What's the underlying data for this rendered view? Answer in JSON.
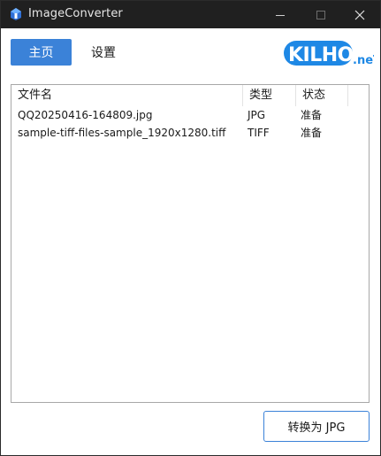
{
  "window": {
    "title": "ImageConverter",
    "icon": "app-icon",
    "controls": [
      "minimize-icon",
      "maximize-icon",
      "close-icon"
    ]
  },
  "nav": {
    "home_label": "主页",
    "settings_label": "设置",
    "active": "home",
    "accent_color": "#3b82d8"
  },
  "logo": {
    "text": "KILHO",
    "suffix": ".neT",
    "color": "#1e88e5"
  },
  "file_list": {
    "columns": [
      "文件名",
      "类型",
      "状态"
    ],
    "rows": [
      {
        "name": "QQ20250416-164809.jpg",
        "type": "JPG",
        "status": "准备"
      },
      {
        "name": "sample-tiff-files-sample_1920x1280.tiff",
        "type": "TIFF",
        "status": "准备"
      }
    ]
  },
  "actions": {
    "convert_label": "转换为 JPG"
  }
}
